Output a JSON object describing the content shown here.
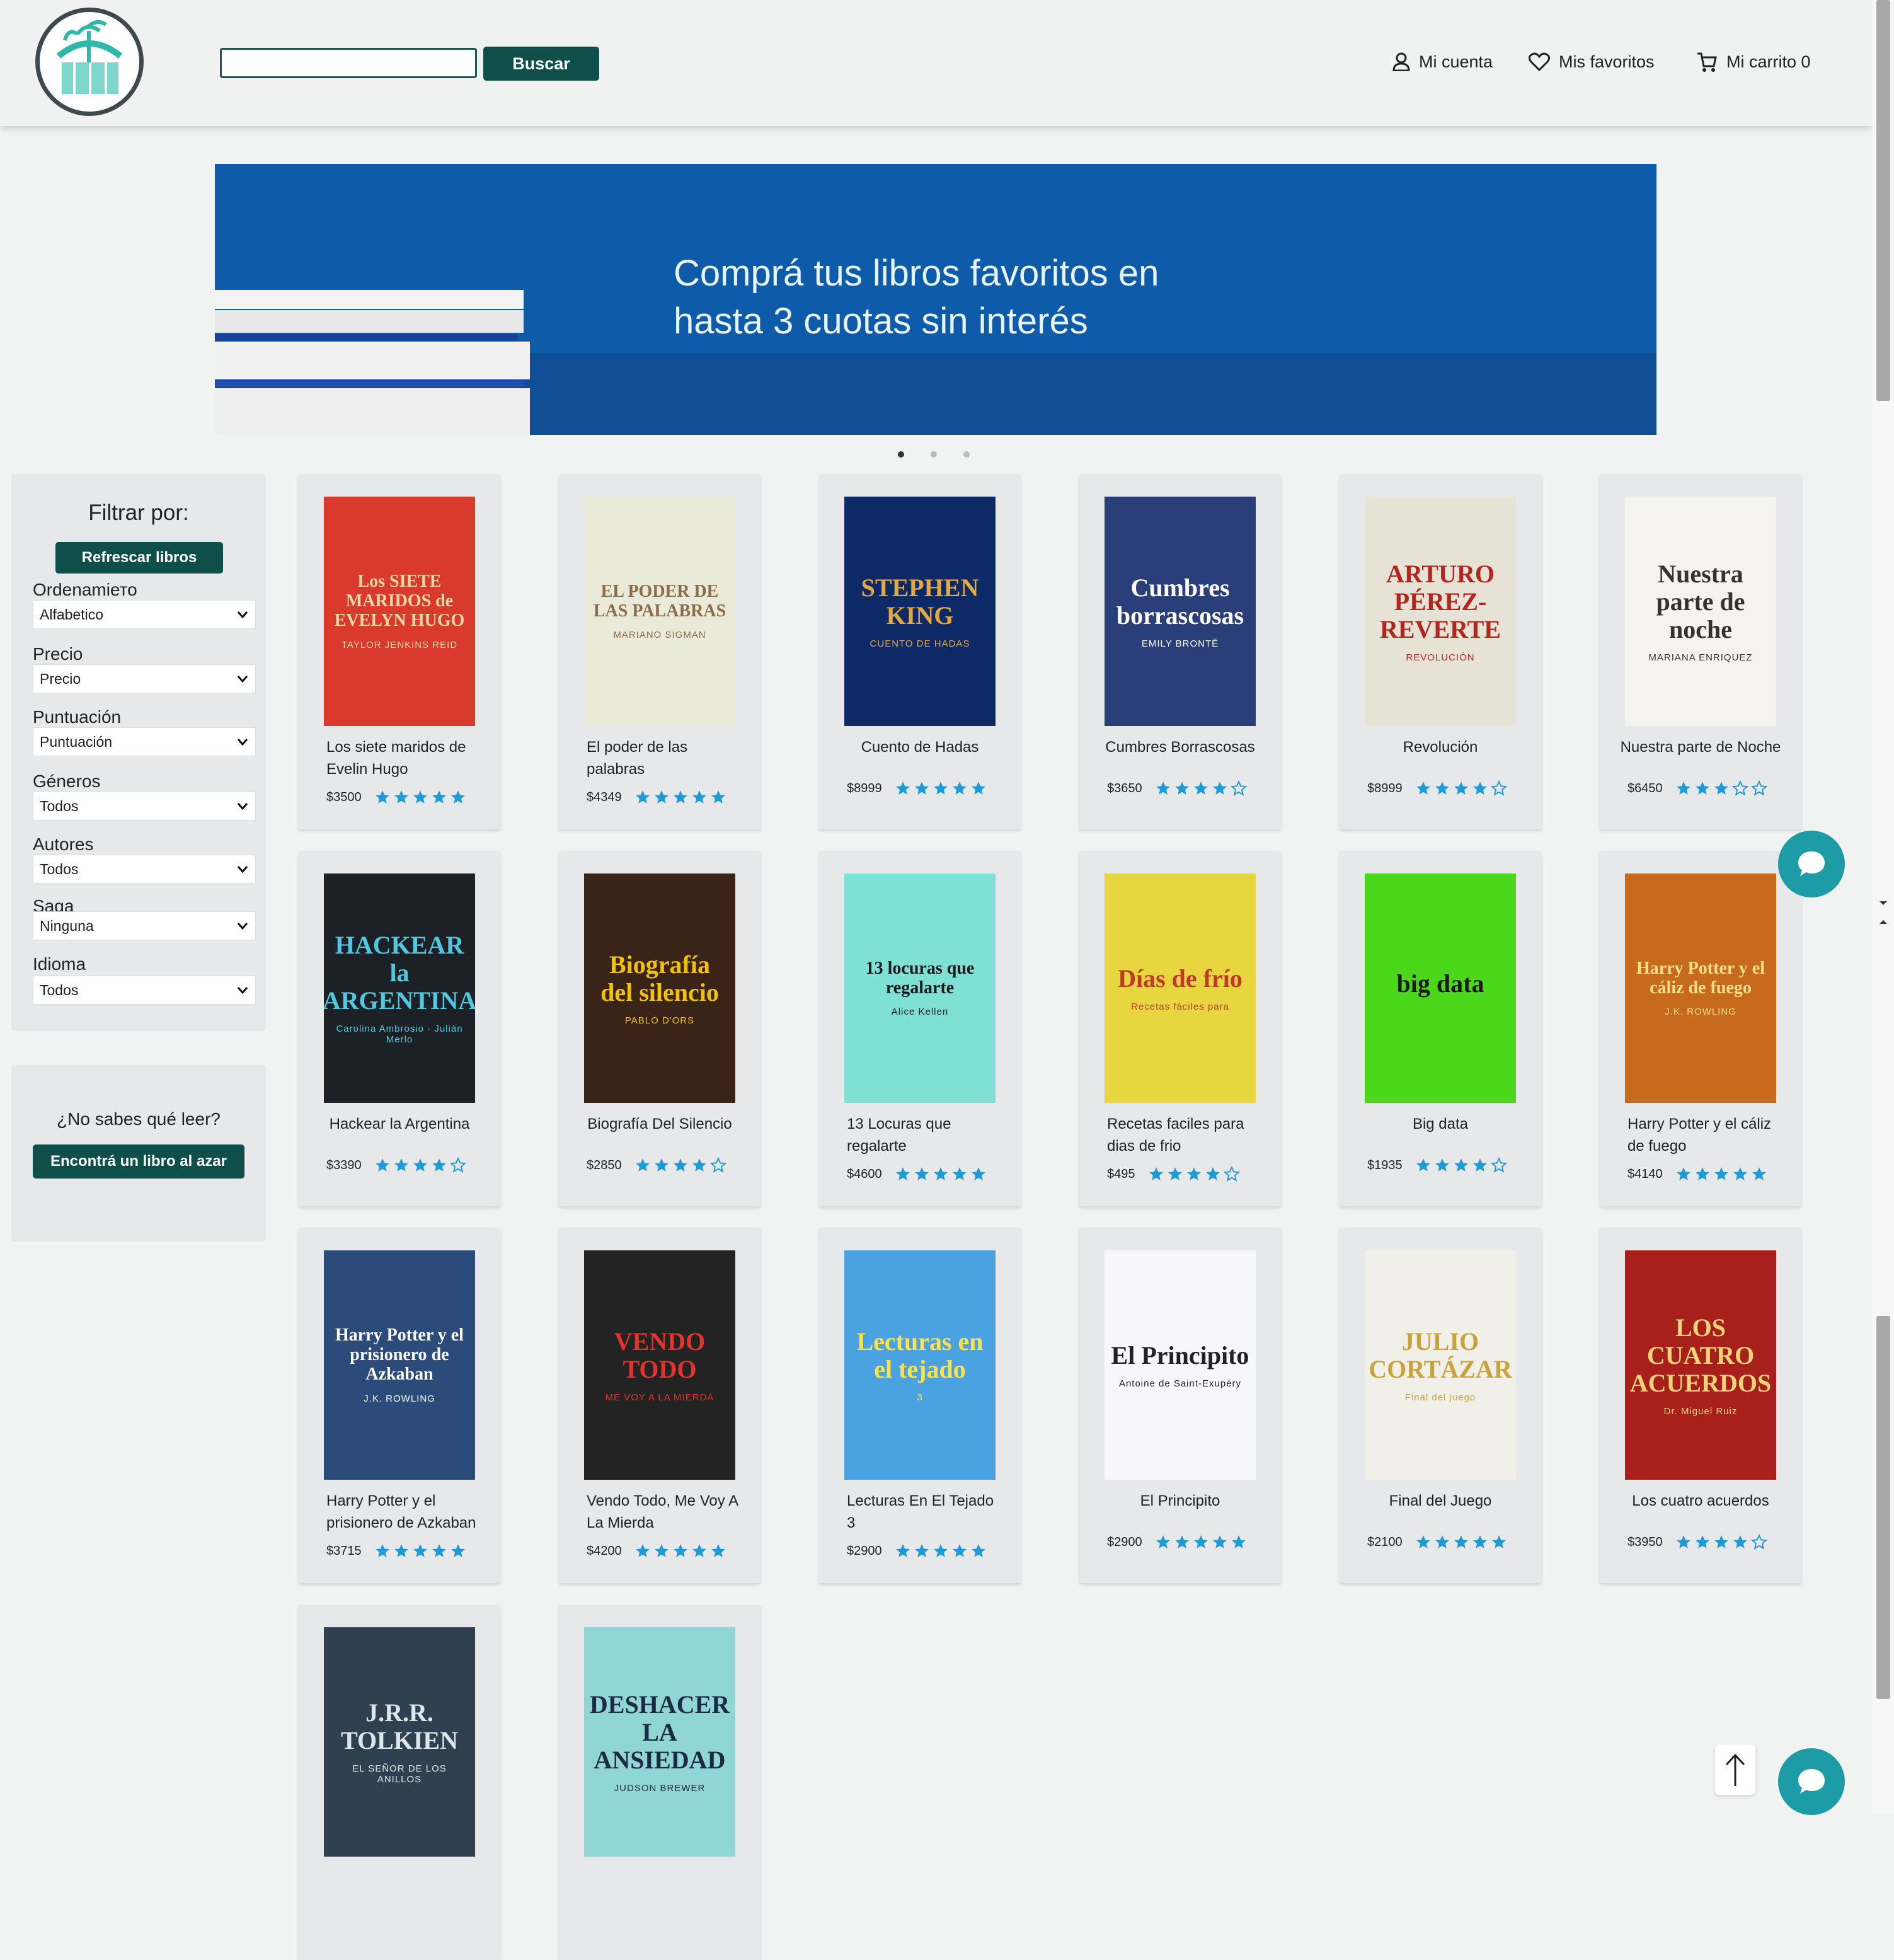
{
  "header": {
    "search_placeholder": "",
    "search_button": "Buscar",
    "account": "Mi cuenta",
    "favorites": "Mis favoritos",
    "cart": "Mi carrito 0"
  },
  "banner": {
    "line1": "Comprá tus libros favoritos en",
    "line2": "hasta 3 cuotas sin interés",
    "slide_count": 3,
    "active_slide": 1
  },
  "filters": {
    "title": "Filtrar por:",
    "refresh": "Refrescar libros",
    "fields": [
      {
        "label": "Ordenamiето",
        "value": "Alfabetico"
      },
      {
        "label": "Precio",
        "value": "Precio"
      },
      {
        "label": "Puntuación",
        "value": "Puntuación"
      },
      {
        "label": "Géneros",
        "value": "Todos"
      },
      {
        "label": "Autores",
        "value": "Todos"
      },
      {
        "label": "Saga",
        "value": "Ninguna"
      },
      {
        "label": "Idioma",
        "value": "Todos"
      }
    ]
  },
  "random": {
    "question": "¿No sabes qué leer?",
    "button": "Encontrá un libro al azar"
  },
  "colors": {
    "primary": "#0f4f4a",
    "star": "#1e9ad6",
    "chat": "#1d9ba7"
  },
  "books": [
    {
      "title": "Los siete maridos de Evelin Hugo",
      "price": "$3500",
      "rating": 5,
      "cover_title": "Los SIETE MARIDOS de EVELYN HUGO",
      "cover_author": "TAYLOR JENKINS REID",
      "bg": "#d93a2b",
      "fg": "#f6d9a6"
    },
    {
      "title": "El poder de las palabras",
      "price": "$4349",
      "rating": 5,
      "cover_title": "EL PODER DE LAS PALABRAS",
      "cover_author": "MARIANO SIGMAN",
      "bg": "#e9ead8",
      "fg": "#8a6d4b"
    },
    {
      "title": "Cuento de Hadas",
      "price": "$8999",
      "rating": 5,
      "cover_title": "STEPHEN KING",
      "cover_author": "CUENTO DE HADAS",
      "bg": "#0e2a66",
      "fg": "#e1a847"
    },
    {
      "title": "Cumbres Borrascosas",
      "price": "$3650",
      "rating": 4,
      "cover_title": "Cumbres borrascosas",
      "cover_author": "EMILY BRONTË",
      "bg": "#2a3f7a",
      "fg": "#ffffff"
    },
    {
      "title": "Revolución",
      "price": "$8999",
      "rating": 4,
      "cover_title": "ARTURO PÉREZ-REVERTE",
      "cover_author": "REVOLUCIÓN",
      "bg": "#e6e2d6",
      "fg": "#b3261e"
    },
    {
      "title": "Nuestra parte de Noche",
      "price": "$6450",
      "rating": 3,
      "cover_title": "Nuestra parte de noche",
      "cover_author": "MARIANA ENRIQUEZ",
      "bg": "#f5f3ee",
      "fg": "#333333"
    },
    {
      "title": "Hackear la Argentina",
      "price": "$3390",
      "rating": 4,
      "cover_title": "HACKEAR la ARGENTINA",
      "cover_author": "Carolina Ambrosio · Julián Merlo",
      "bg": "#1c2126",
      "fg": "#4fc8e0"
    },
    {
      "title": "Biografía Del Silencio",
      "price": "$2850",
      "rating": 4,
      "cover_title": "Biografía del silencio",
      "cover_author": "PABLO D'ORS",
      "bg": "#3a2418",
      "fg": "#f2c200"
    },
    {
      "title": "13 Locuras que regalarte",
      "price": "$4600",
      "rating": 5,
      "cover_title": "13 locuras que regalarte",
      "cover_author": "Alice Kellen",
      "bg": "#7fe0d6",
      "fg": "#1a1a1a"
    },
    {
      "title": "Recetas faciles para dias de frio",
      "price": "$495",
      "rating": 4,
      "cover_title": "Días de frío",
      "cover_author": "Recetas fáciles para",
      "bg": "#e8d640",
      "fg": "#c0392b"
    },
    {
      "title": "Big data",
      "price": "$1935",
      "rating": 4,
      "cover_title": "big data",
      "cover_author": "",
      "bg": "#4cd81a",
      "fg": "#1a1a1a"
    },
    {
      "title": "Harry Potter y el cáliz de fuego",
      "price": "$4140",
      "rating": 5,
      "cover_title": "Harry Potter y el cáliz de fuego",
      "cover_author": "J.K. ROWLING",
      "bg": "#c86a1e",
      "fg": "#ffe08a"
    },
    {
      "title": "Harry Potter y el prisionero de Azkaban",
      "price": "$3715",
      "rating": 5,
      "cover_title": "Harry Potter y el prisionero de Azkaban",
      "cover_author": "J.K. ROWLING",
      "bg": "#2b4b7a",
      "fg": "#ffffff"
    },
    {
      "title": "Vendo Todo, Me Voy A La Mierda",
      "price": "$4200",
      "rating": 5,
      "cover_title": "VENDO TODO",
      "cover_author": "ME VOY A LA MIERDA",
      "bg": "#232323",
      "fg": "#e0352c"
    },
    {
      "title": "Lecturas En El Tejado 3",
      "price": "$2900",
      "rating": 5,
      "cover_title": "Lecturas en el tejado",
      "cover_author": "3",
      "bg": "#4aa3e0",
      "fg": "#ffe14a"
    },
    {
      "title": "El Principito",
      "price": "$2900",
      "rating": 5,
      "cover_title": "El Principito",
      "cover_author": "Antoine de Saint-Exupéry",
      "bg": "#f7f7fb",
      "fg": "#222222"
    },
    {
      "title": "Final del Juego",
      "price": "$2100",
      "rating": 5,
      "cover_title": "JULIO CORTÁZAR",
      "cover_author": "Final del juego",
      "bg": "#f0f0e8",
      "fg": "#c8a23a"
    },
    {
      "title": "Los cuatro acuerdos",
      "price": "$3950",
      "rating": 4,
      "cover_title": "LOS CUATRO ACUERDOS",
      "cover_author": "Dr. Miguel Ruiz",
      "bg": "#a8201c",
      "fg": "#f5d37a"
    },
    {
      "title": "",
      "price": "",
      "rating": 0,
      "cover_title": "J.R.R. TOLKIEN",
      "cover_author": "EL SEÑOR DE LOS ANILLOS",
      "bg": "#2f4150",
      "fg": "#dfe6ea"
    },
    {
      "title": "",
      "price": "",
      "rating": 0,
      "cover_title": "DESHACER LA ANSIEDAD",
      "cover_author": "JUDSON BREWER",
      "bg": "#8fd6d4",
      "fg": "#1c2a44"
    }
  ]
}
